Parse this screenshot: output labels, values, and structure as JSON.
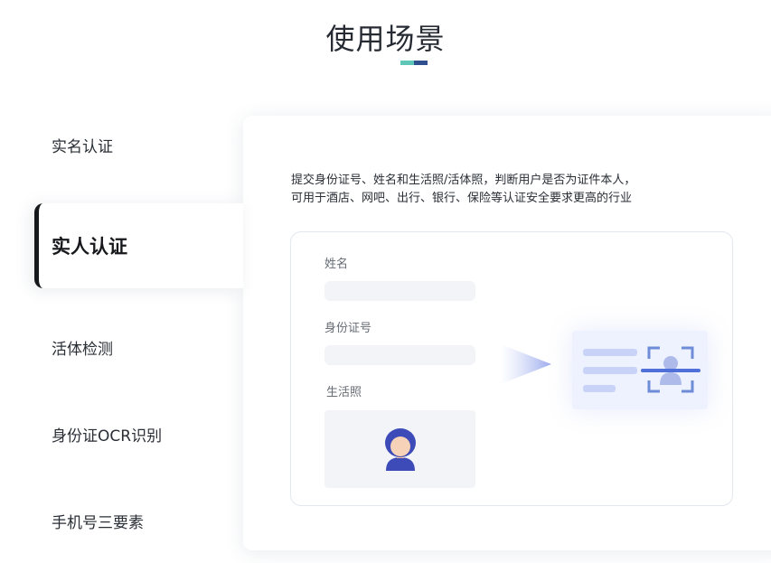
{
  "page": {
    "title": "使用场景",
    "accent_colors": [
      "#5fc7b8",
      "#2f4f8f"
    ]
  },
  "tabs": [
    {
      "label": "实名认证",
      "active": false
    },
    {
      "label": "实人认证",
      "active": true
    },
    {
      "label": "活体检测",
      "active": false
    },
    {
      "label": "身份证OCR识别",
      "active": false
    },
    {
      "label": "手机号三要素",
      "active": false
    }
  ],
  "panel": {
    "description_line1": "提交身份证号、姓名和生活照/活体照，判断用户是否为证件本人，",
    "description_line2": "可用于酒店、网吧、出行、银行、保险等认证安全要求更高的行业",
    "form": {
      "name_label": "姓名",
      "id_label": "身份证号",
      "photo_label": "生活照"
    },
    "icons": {
      "avatar": "avatar-icon",
      "arrow": "arrow-right-icon",
      "scan": "face-scan-icon"
    }
  }
}
